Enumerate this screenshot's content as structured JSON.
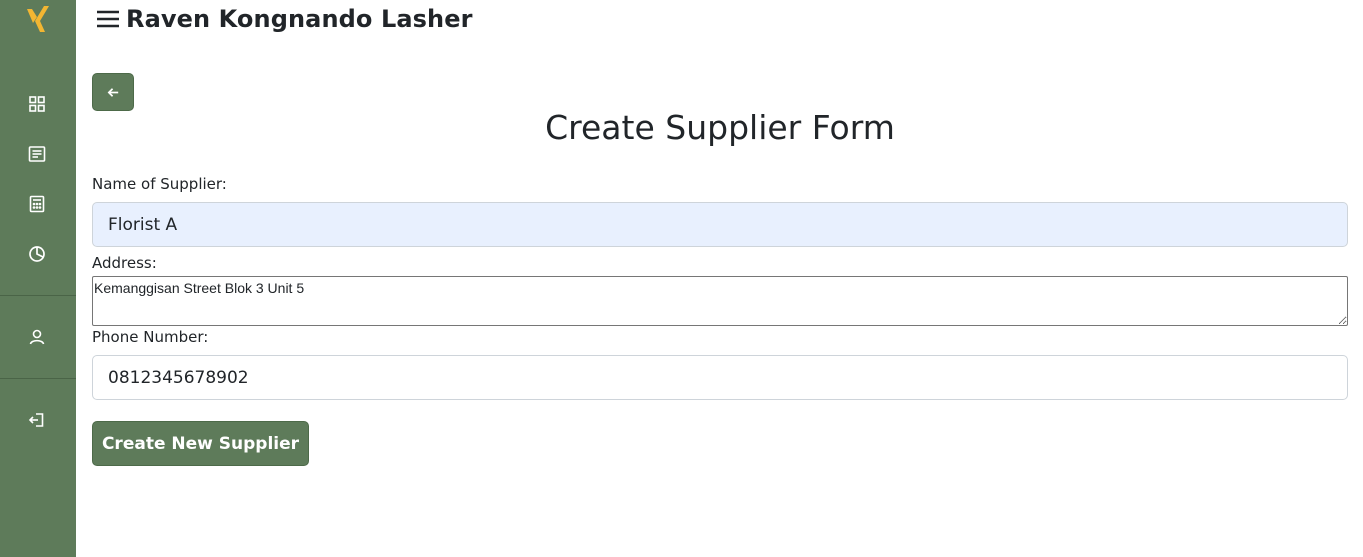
{
  "header": {
    "user_name": "Raven Kongnando Lasher"
  },
  "sidebar": {
    "icons": [
      "logo-x-icon",
      "dashboard-grid-icon",
      "document-list-icon",
      "calculator-icon",
      "pie-chart-icon",
      "user-icon",
      "logout-icon"
    ]
  },
  "form": {
    "title": "Create Supplier Form",
    "name_label": "Name of Supplier:",
    "name_value": "Florist A",
    "address_label": "Address:",
    "address_value": "Kemanggisan Street Blok 3 Unit 5",
    "phone_label": "Phone Number:",
    "phone_value": "0812345678902",
    "submit_label": "Create New Supplier"
  },
  "colors": {
    "sidebar_bg": "#5e7b5a",
    "logo_accent": "#f2b632",
    "autofill_bg": "#e8f0fe"
  }
}
